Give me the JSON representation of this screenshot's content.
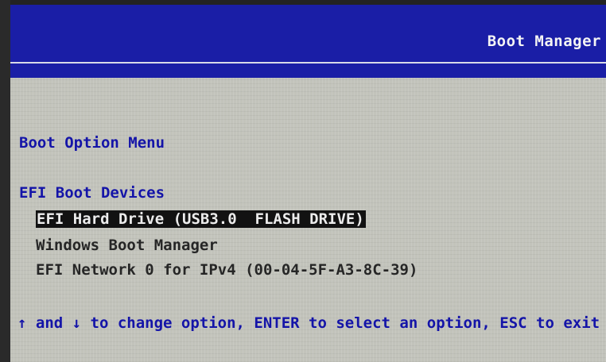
{
  "header": {
    "title": "Boot Manager"
  },
  "menu": {
    "title": "Boot Option Menu",
    "section_title": "EFI Boot Devices",
    "items": [
      {
        "label": "EFI Hard Drive (USB3.0  FLASH DRIVE)",
        "selected": true
      },
      {
        "label": "Windows Boot Manager",
        "selected": false
      },
      {
        "label": "EFI Network 0 for IPv4 (00-04-5F-A3-8C-39)",
        "selected": false
      }
    ]
  },
  "help": {
    "text": "↑ and ↓ to change option, ENTER to select an option, ESC to exit"
  },
  "colors": {
    "header_bg": "#1a1ea6",
    "body_bg": "#c2c3bb",
    "accent_text": "#1414a8",
    "selection_bg": "#121212"
  }
}
